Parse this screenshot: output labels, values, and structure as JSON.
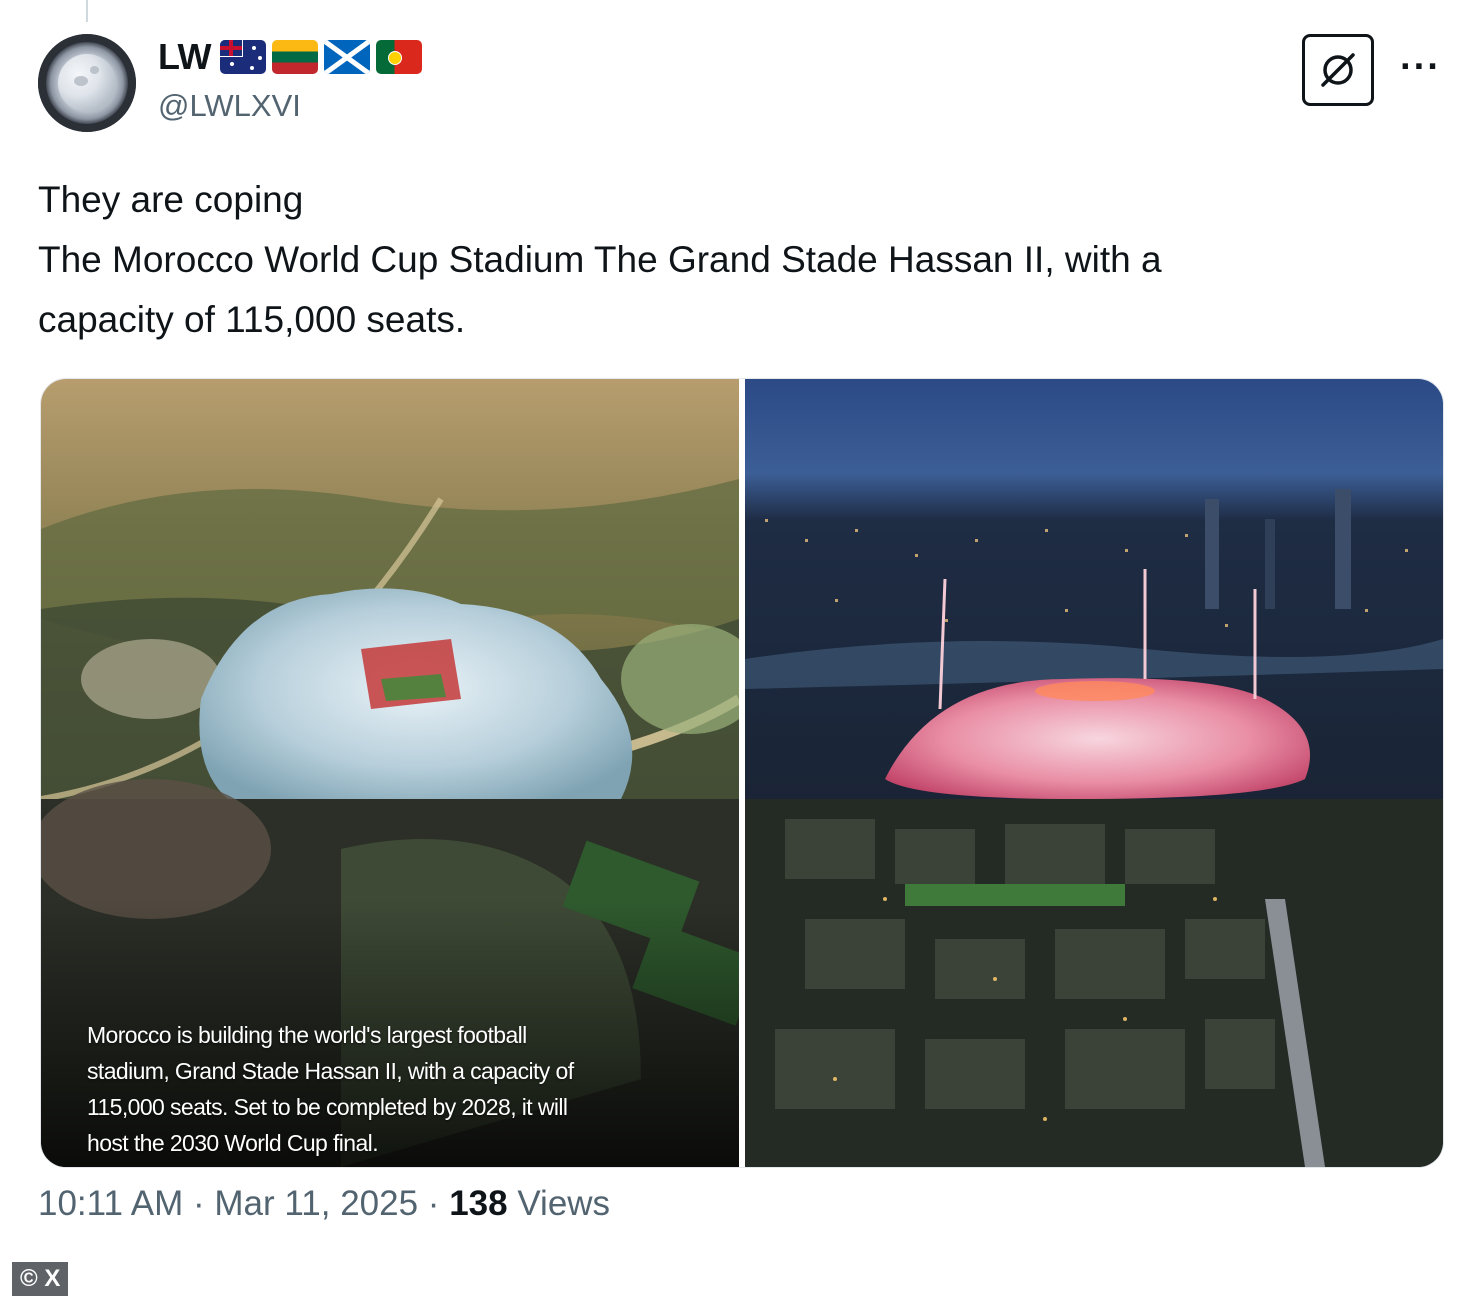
{
  "author": {
    "display_name": "LW",
    "handle": "@LWLXVI",
    "flags": [
      "Australia flag",
      "Lithuania flag",
      "Scotland flag",
      "Portugal flag"
    ]
  },
  "icons": {
    "grok": "grok-icon",
    "more": "more-icon"
  },
  "more_label": "···",
  "tweet": {
    "lines": [
      "They are coping",
      "The Morocco World Cup Stadium The Grand Stade Hassan II, with a",
      "capacity of 115,000 seats."
    ]
  },
  "media": {
    "left_caption": [
      "Morocco is building the world's largest football",
      "stadium, Grand Stade Hassan II, with a capacity of",
      "115,000 seats. Set to be completed by 2028, it will",
      "host the 2030 World Cup final."
    ]
  },
  "meta": {
    "time": "10:11 AM",
    "separator": "·",
    "date": "Mar 11, 2025",
    "views_count": "138",
    "views_label": "Views"
  },
  "watermark": "© X",
  "colors": {
    "text_primary": "#0f1419",
    "text_secondary": "#536471"
  }
}
